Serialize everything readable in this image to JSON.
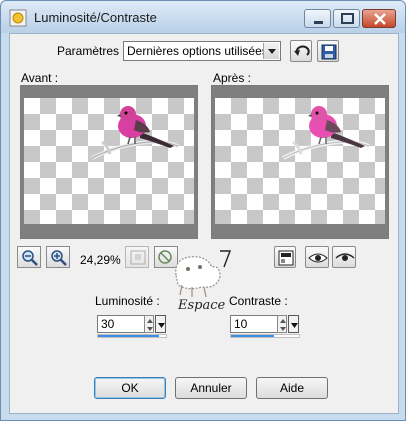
{
  "window": {
    "title": "Luminosité/Contraste",
    "controls": [
      "minimize",
      "maximize",
      "close"
    ]
  },
  "parameters": {
    "label": "Paramètres :",
    "selected": "Dernières options utilisées",
    "icons": [
      "reset-arrow-icon",
      "save-disk-icon"
    ]
  },
  "preview": {
    "before_label": "Avant :",
    "after_label": "Après :"
  },
  "zoom": {
    "value": "24,29%",
    "icons": [
      "zoom-out-icon",
      "zoom-in-icon",
      "fit-window-icon",
      "navigate-icon"
    ]
  },
  "view_modes": [
    "single-preview-icon",
    "eye-icon",
    "eye-icon"
  ],
  "watermark_text": "Espace 7",
  "luminosity": {
    "label": "Luminosité :",
    "value": "30",
    "slider_fraction": 0.9
  },
  "contrast": {
    "label": "Contraste :",
    "value": "10",
    "slider_fraction": 0.63
  },
  "buttons": {
    "ok": "OK",
    "cancel": "Annuler",
    "help": "Aide"
  },
  "colors": {
    "titlebar": "#c9dced",
    "slider_fill": "#3d8ee6",
    "bird_pink": "#d93fa3",
    "close_button": "#c6472b"
  }
}
